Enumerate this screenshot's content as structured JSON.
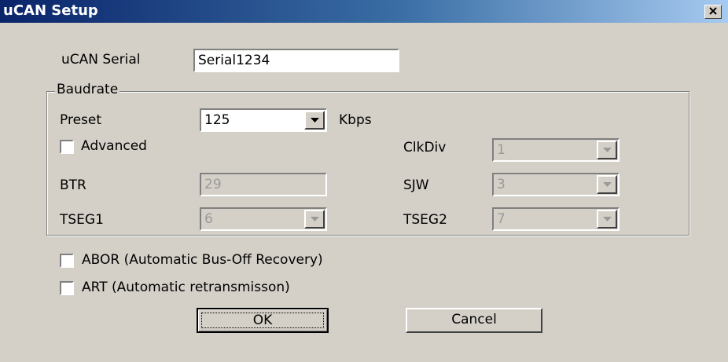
{
  "window": {
    "title": "uCAN Setup",
    "close_label": "x"
  },
  "serial": {
    "label": "uCAN Serial",
    "value": "Serial1234"
  },
  "baudrate": {
    "group_label": "Baudrate",
    "preset_label": "Preset",
    "preset_value": "125",
    "unit": "Kbps",
    "advanced_label": "Advanced",
    "clkdiv_label": "ClkDiv",
    "clkdiv_value": "1",
    "btr_label": "BTR",
    "btr_value": "29",
    "sjw_label": "SJW",
    "sjw_value": "3",
    "tseg1_label": "TSEG1",
    "tseg1_value": "6",
    "tseg2_label": "TSEG2",
    "tseg2_value": "7"
  },
  "options": {
    "abor_label": "ABOR (Automatic Bus-Off Recovery)",
    "art_label": "ART (Automatic retransmisson)"
  },
  "buttons": {
    "ok": "OK",
    "cancel": "Cancel"
  },
  "colors": {
    "face": "#d4d0c8",
    "title_start": "#0a246a",
    "title_end": "#a6caf0",
    "disabled_text": "#9a9a9a"
  },
  "icons": {
    "dropdown": "chevron-down-icon",
    "close": "close-icon"
  }
}
